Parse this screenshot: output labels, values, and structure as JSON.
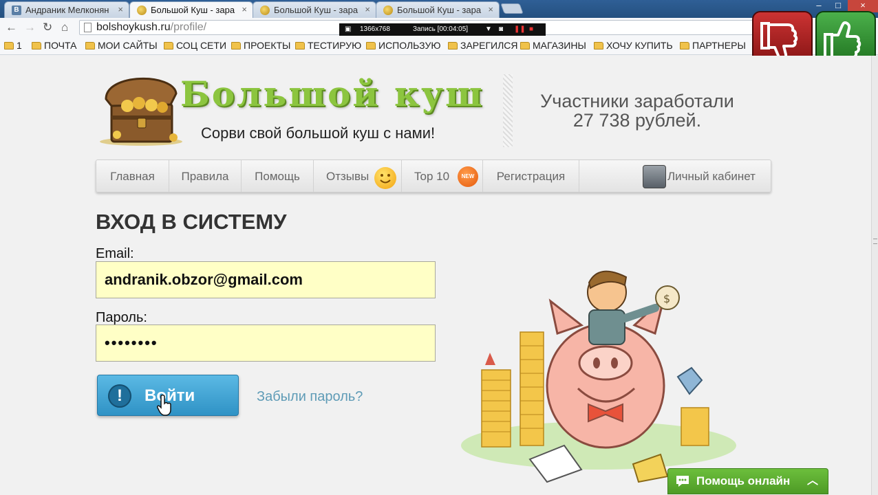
{
  "browser": {
    "tabs": [
      {
        "title": "Андраник Мелконян",
        "favicon": "vk-icon"
      },
      {
        "title": "Большой Куш - зара",
        "favicon": "coin-icon"
      },
      {
        "title": "Большой Куш - зара",
        "favicon": "coin-icon"
      },
      {
        "title": "Большой Куш - зара",
        "favicon": "coin-icon"
      }
    ],
    "active_tab": 1,
    "url_host": "bolshoykush.ru",
    "url_path": "/profile/",
    "recorder": {
      "resolution": "1366x768",
      "status": "Запись [00:04:05]"
    },
    "bookmarks": [
      "1",
      "ПОЧТА",
      "МОИ САЙТЫ",
      "СОЦ СЕТИ",
      "ПРОЕКТЫ",
      "ТЕСТИРУЮ",
      "ИСПОЛЬЗУЮ",
      "ЗАРЕГИЛСЯ",
      "МАГАЗИНЫ",
      "ХОЧУ КУПИТЬ",
      "ПАРТНЕРЫ"
    ]
  },
  "overlay": {
    "thumb_down_color": "#b82222",
    "thumb_up_color": "#3a9a3a"
  },
  "header": {
    "logo_text": "Большой куш",
    "tagline": "Сорви свой большой куш с нами!",
    "earned_line1": "Участники заработали",
    "earned_line2": "27 738 рублей."
  },
  "menu": {
    "home": "Главная",
    "rules": "Правила",
    "help": "Помощь",
    "reviews": "Отзывы",
    "top10": "Top 10",
    "new_badge": "NEW",
    "register": "Регистрация",
    "cabinet": "Личный кабинет"
  },
  "login": {
    "title": "ВХОД В СИСТЕМУ",
    "email_label": "Email:",
    "email_value": "andranik.obzor@gmail.com",
    "password_label": "Пароль:",
    "password_value": "••••••••",
    "submit_label": "Войти",
    "forgot_label": "Забыли пароль?"
  },
  "help_widget": {
    "label": "Помощь онлайн",
    "color": "#5aab2f"
  },
  "colors": {
    "logo_green": "#8cc53f",
    "input_bg": "#ffffc6",
    "button_blue": "#3a9fd2",
    "link": "#5e9bb6"
  }
}
